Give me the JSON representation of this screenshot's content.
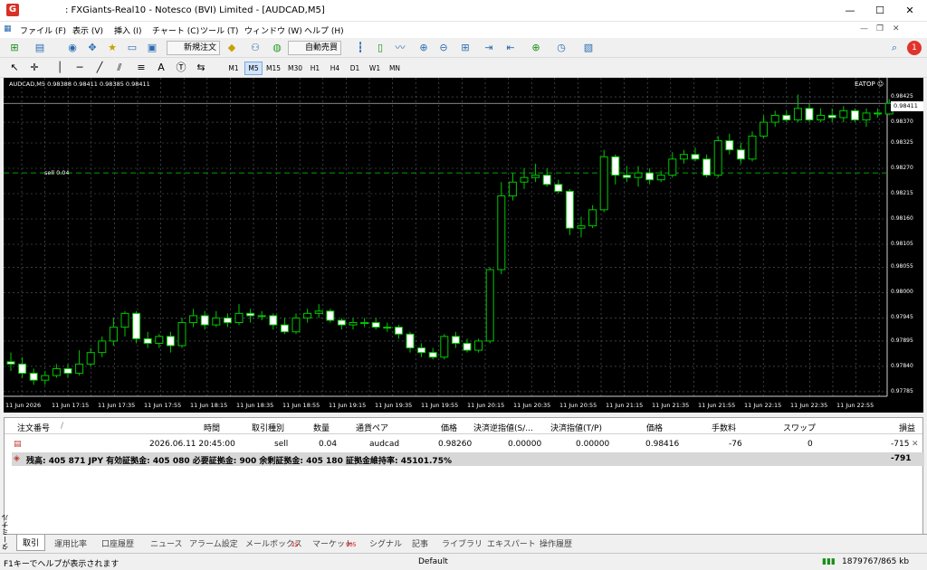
{
  "window": {
    "title": ": FXGiants-Real10 - Notesco (BVI) Limited - [AUDCAD,M5]",
    "app_icon": "G",
    "min": "—",
    "max": "☐",
    "close": "✕"
  },
  "menu": [
    {
      "label": "ファイル (F)"
    },
    {
      "label": "表示 (V)"
    },
    {
      "label": "挿入 (I)"
    },
    {
      "label": "チャート (C)"
    },
    {
      "label": "ツール (T)"
    },
    {
      "label": "ウィンドウ (W)"
    },
    {
      "label": "ヘルプ (H)"
    }
  ],
  "menu_right": {
    "notif_count": "1"
  },
  "toolbar": {
    "new_order": "新規注文",
    "auto_trade": "自動売買"
  },
  "timeframes": [
    "M1",
    "M5",
    "M15",
    "M30",
    "H1",
    "H4",
    "D1",
    "W1",
    "MN"
  ],
  "timeframe_selected": "M5",
  "chart": {
    "symbol_info": "AUDCAD,M5  0.98388 0.98411 0.98385 0.98411",
    "ea_label": "EATOP ☺",
    "sell_label": "sell 0.04",
    "bid_tag": "0.98411",
    "price_labels": [
      "0.98425",
      "0.98370",
      "0.98325",
      "0.98270",
      "0.98215",
      "0.98160",
      "0.98105",
      "0.98055",
      "0.98000",
      "0.97945",
      "0.97895",
      "0.97840",
      "0.97785"
    ],
    "time_labels": [
      "11 Jun 2026",
      "11 Jun 17:15",
      "11 Jun 17:35",
      "11 Jun 17:55",
      "11 Jun 18:15",
      "11 Jun 18:35",
      "11 Jun 18:55",
      "11 Jun 19:15",
      "11 Jun 19:35",
      "11 Jun 19:55",
      "11 Jun 20:15",
      "11 Jun 20:35",
      "11 Jun 20:55",
      "11 Jun 21:15",
      "11 Jun 21:35",
      "11 Jun 21:55",
      "11 Jun 22:15",
      "11 Jun 22:35",
      "11 Jun 22:55"
    ],
    "colors": {
      "bg": "#000000",
      "up": "#00c800",
      "down_body": "#ffffff",
      "grid": "#5a6470",
      "sell_line": "#00a000",
      "bid_line": "#b4b4b4"
    }
  },
  "chart_data": {
    "type": "candlestick",
    "symbol": "AUDCAD",
    "timeframe": "M5",
    "ylim": [
      0.97775,
      0.98435
    ],
    "sell_entry": 0.9826,
    "bid": 0.98411,
    "candles": [
      [
        0.9785,
        0.97845,
        0.9787,
        0.9783
      ],
      [
        0.97845,
        0.97825,
        0.9786,
        0.97815
      ],
      [
        0.97825,
        0.9781,
        0.97835,
        0.978
      ],
      [
        0.9781,
        0.9782,
        0.9783,
        0.978
      ],
      [
        0.9782,
        0.97835,
        0.97845,
        0.97815
      ],
      [
        0.97835,
        0.97825,
        0.97845,
        0.97815
      ],
      [
        0.97825,
        0.97845,
        0.97875,
        0.9782
      ],
      [
        0.97845,
        0.9787,
        0.9788,
        0.9784
      ],
      [
        0.9787,
        0.97895,
        0.97905,
        0.9786
      ],
      [
        0.97895,
        0.97925,
        0.97945,
        0.97885
      ],
      [
        0.97925,
        0.97955,
        0.9796,
        0.97905
      ],
      [
        0.97955,
        0.979,
        0.9796,
        0.9789
      ],
      [
        0.979,
        0.9789,
        0.97915,
        0.9788
      ],
      [
        0.9789,
        0.97905,
        0.9791,
        0.9788
      ],
      [
        0.97905,
        0.97885,
        0.97915,
        0.9787
      ],
      [
        0.97885,
        0.97935,
        0.97945,
        0.9788
      ],
      [
        0.97935,
        0.9795,
        0.97965,
        0.97925
      ],
      [
        0.9795,
        0.9793,
        0.9796,
        0.9792
      ],
      [
        0.9793,
        0.97945,
        0.9796,
        0.97925
      ],
      [
        0.97945,
        0.97935,
        0.97955,
        0.97925
      ],
      [
        0.97935,
        0.97955,
        0.97975,
        0.9793
      ],
      [
        0.97955,
        0.9795,
        0.97965,
        0.97935
      ],
      [
        0.9795,
        0.9795,
        0.9796,
        0.9794
      ],
      [
        0.9795,
        0.9793,
        0.97955,
        0.9792
      ],
      [
        0.9793,
        0.97915,
        0.97945,
        0.9791
      ],
      [
        0.97915,
        0.97945,
        0.97955,
        0.9791
      ],
      [
        0.97945,
        0.97955,
        0.97965,
        0.97935
      ],
      [
        0.97955,
        0.9796,
        0.97975,
        0.97945
      ],
      [
        0.9796,
        0.9794,
        0.97965,
        0.97935
      ],
      [
        0.9794,
        0.9793,
        0.97945,
        0.9792
      ],
      [
        0.9793,
        0.97935,
        0.97945,
        0.9792
      ],
      [
        0.97935,
        0.97935,
        0.97945,
        0.97925
      ],
      [
        0.97935,
        0.97925,
        0.97945,
        0.9792
      ],
      [
        0.97925,
        0.97925,
        0.97935,
        0.97915
      ],
      [
        0.97925,
        0.9791,
        0.9793,
        0.979
      ],
      [
        0.9791,
        0.9788,
        0.97915,
        0.9787
      ],
      [
        0.9788,
        0.9787,
        0.9789,
        0.9786
      ],
      [
        0.9787,
        0.9786,
        0.9788,
        0.97855
      ],
      [
        0.9786,
        0.97905,
        0.9791,
        0.97855
      ],
      [
        0.97905,
        0.9789,
        0.97915,
        0.9788
      ],
      [
        0.9789,
        0.97875,
        0.979,
        0.9787
      ],
      [
        0.97875,
        0.97895,
        0.979,
        0.9787
      ],
      [
        0.97895,
        0.9805,
        0.98055,
        0.9789
      ],
      [
        0.9805,
        0.9821,
        0.9824,
        0.9804
      ],
      [
        0.9821,
        0.9824,
        0.9826,
        0.982
      ],
      [
        0.9824,
        0.9825,
        0.9827,
        0.98225
      ],
      [
        0.9825,
        0.98255,
        0.9828,
        0.9824
      ],
      [
        0.98255,
        0.98235,
        0.9827,
        0.9823
      ],
      [
        0.98235,
        0.9822,
        0.98245,
        0.98215
      ],
      [
        0.9822,
        0.9814,
        0.98225,
        0.98125
      ],
      [
        0.9814,
        0.98145,
        0.98165,
        0.9812
      ],
      [
        0.98145,
        0.9818,
        0.9819,
        0.9814
      ],
      [
        0.9818,
        0.98295,
        0.9831,
        0.98175
      ],
      [
        0.98295,
        0.98255,
        0.983,
        0.98235
      ],
      [
        0.98255,
        0.9825,
        0.98275,
        0.9824
      ],
      [
        0.9825,
        0.9826,
        0.98275,
        0.9823
      ],
      [
        0.9826,
        0.98245,
        0.9827,
        0.98235
      ],
      [
        0.98245,
        0.98255,
        0.98265,
        0.9824
      ],
      [
        0.98255,
        0.9829,
        0.98305,
        0.9825
      ],
      [
        0.9829,
        0.983,
        0.9831,
        0.9828
      ],
      [
        0.983,
        0.9829,
        0.98315,
        0.98285
      ],
      [
        0.9829,
        0.98255,
        0.983,
        0.9825
      ],
      [
        0.98255,
        0.9833,
        0.9834,
        0.9825
      ],
      [
        0.9833,
        0.9831,
        0.98345,
        0.983
      ],
      [
        0.9831,
        0.9829,
        0.98325,
        0.9828
      ],
      [
        0.9829,
        0.9834,
        0.9835,
        0.98285
      ],
      [
        0.9834,
        0.9837,
        0.98385,
        0.98335
      ],
      [
        0.9837,
        0.98385,
        0.98395,
        0.9836
      ],
      [
        0.98385,
        0.98375,
        0.98395,
        0.9837
      ],
      [
        0.98375,
        0.984,
        0.9843,
        0.9837
      ],
      [
        0.984,
        0.98375,
        0.9841,
        0.9837
      ],
      [
        0.98375,
        0.98385,
        0.984,
        0.9837
      ],
      [
        0.98385,
        0.9838,
        0.984,
        0.9837
      ],
      [
        0.9838,
        0.98395,
        0.98405,
        0.9837
      ],
      [
        0.98395,
        0.98375,
        0.984,
        0.9837
      ],
      [
        0.98375,
        0.9839,
        0.984,
        0.9836
      ],
      [
        0.9839,
        0.98388,
        0.984,
        0.9838
      ],
      [
        0.98388,
        0.98411,
        0.9842,
        0.98385
      ]
    ],
    "x_ticks": [
      "11 Jun 2026",
      "11 Jun 17:15",
      "11 Jun 17:35",
      "11 Jun 17:55",
      "11 Jun 18:15",
      "11 Jun 18:35",
      "11 Jun 18:55",
      "11 Jun 19:15",
      "11 Jun 19:35",
      "11 Jun 19:55",
      "11 Jun 20:15",
      "11 Jun 20:35",
      "11 Jun 20:55",
      "11 Jun 21:15",
      "11 Jun 21:35",
      "11 Jun 21:55",
      "11 Jun 22:15",
      "11 Jun 22:35",
      "11 Jun 22:55"
    ],
    "y_ticks": [
      0.98425,
      0.9837,
      0.98325,
      0.9827,
      0.98215,
      0.9816,
      0.98105,
      0.98055,
      0.98,
      0.97945,
      0.97895,
      0.9784,
      0.97785
    ],
    "grid": true
  },
  "terminal": {
    "headers": [
      "注文番号",
      "/",
      "時間",
      "取引種別",
      "数量",
      "通貨ペア",
      "価格",
      "決済逆指値(S/...",
      "決済指値(T/P)",
      "価格",
      "手数料",
      "スワップ",
      "損益"
    ],
    "order": {
      "time": "2026.06.11 20:45:00",
      "type": "sell",
      "volume": "0.04",
      "symbol": "audcad",
      "price": "0.98260",
      "sl": "0.00000",
      "tp": "0.00000",
      "cur_price": "0.98416",
      "commission": "-76",
      "swap": "0",
      "profit": "-715",
      "close": "✕"
    },
    "summary": {
      "text": "残高: 405 871 JPY  有効証拠金: 405 080  必要証拠金: 900  余剰証拠金: 405 180  証拠金維持率: 45101.75%",
      "profit": "-791"
    }
  },
  "side_label": "ターミナル",
  "tabs": [
    {
      "label": "取引"
    },
    {
      "label": "運用比率"
    },
    {
      "label": "口座履歴"
    },
    {
      "label": "ニュース"
    },
    {
      "label": "アラーム設定"
    },
    {
      "label": "メールボックス",
      "badge": "25"
    },
    {
      "label": "マーケット",
      "badge": "905"
    },
    {
      "label": "シグナル"
    },
    {
      "label": "記事"
    },
    {
      "label": "ライブラリ"
    },
    {
      "label": "エキスパート"
    },
    {
      "label": "操作履歴"
    }
  ],
  "status": {
    "help": "F1キーでヘルプが表示されます",
    "profile": "Default",
    "traffic": "1879767/865 kb"
  }
}
